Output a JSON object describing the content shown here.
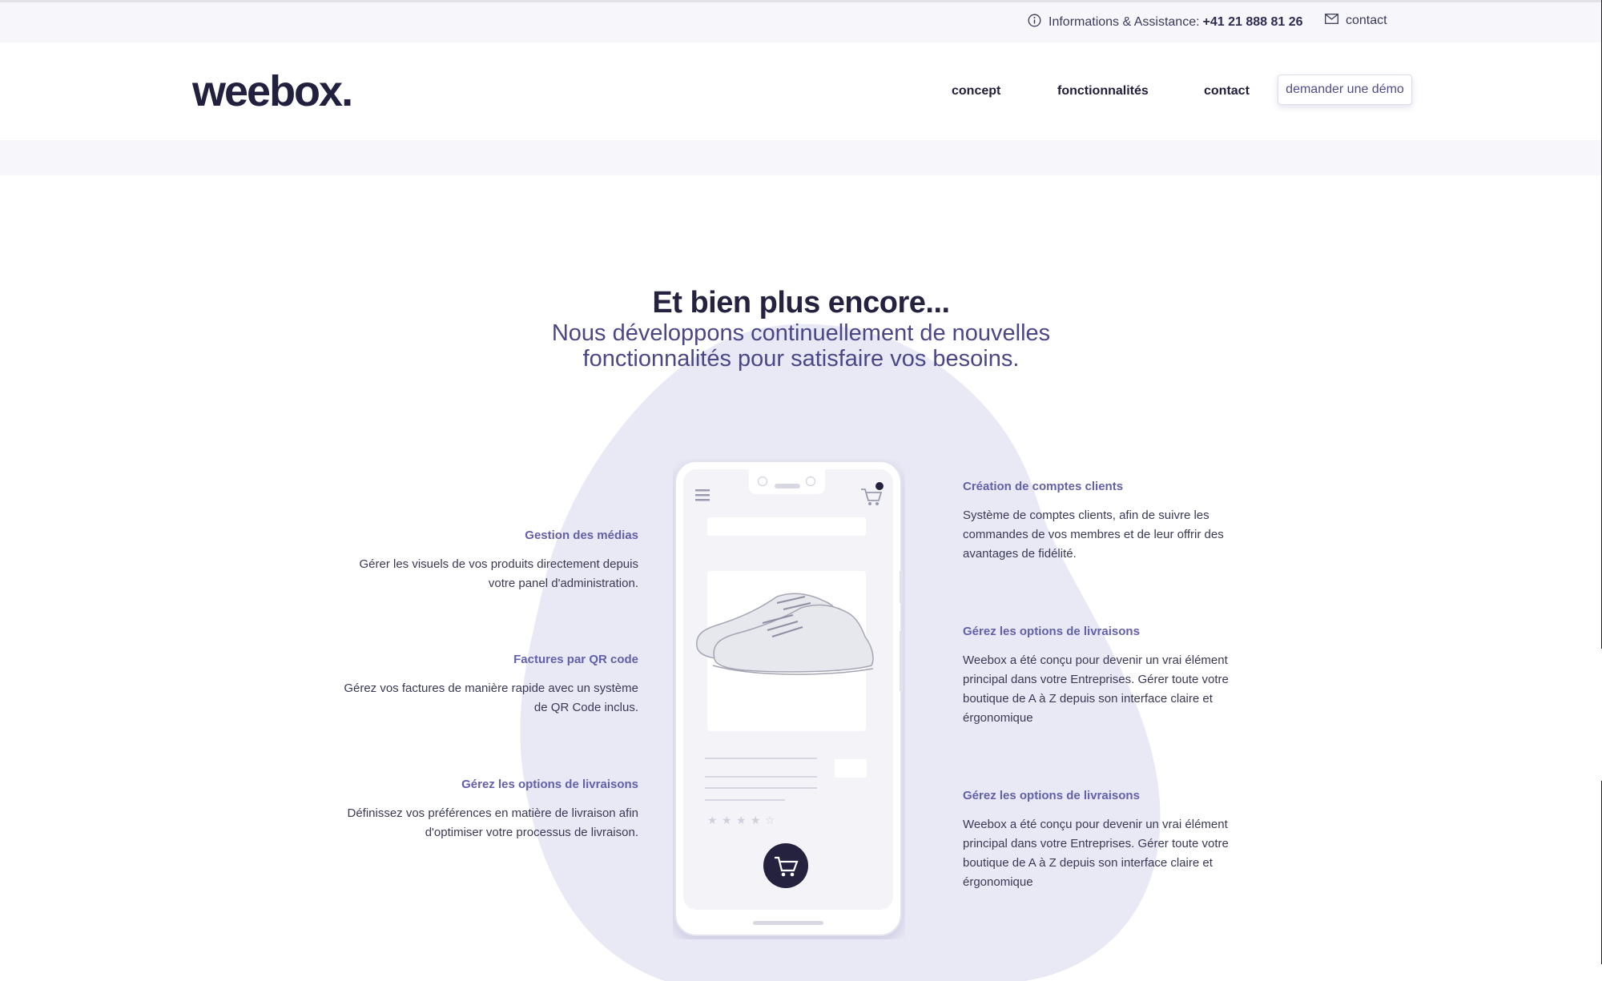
{
  "topbar": {
    "info_label": "Informations & Assistance:",
    "phone": "+41 21 888 81 26",
    "contact_label": "contact"
  },
  "header": {
    "logo": "weebox.",
    "nav": [
      "concept",
      "fonctionnalités",
      "contact"
    ],
    "demo_button": "demander une démo"
  },
  "hero": {
    "title": "Et bien plus encore...",
    "subtitle_line1": "Nous développons continuellement de nouvelles",
    "subtitle_line2": "fonctionnalités pour satisfaire vos besoins."
  },
  "features_left": [
    {
      "title": "Gestion des médias",
      "line1": "Gérer les visuels de vos produits directement depuis",
      "line2": "votre panel d'administration."
    },
    {
      "title": "Factures par QR code",
      "line1": "Gérez vos factures de manière rapide avec un système",
      "line2": "de QR Code inclus."
    },
    {
      "title": "Gérez les options de livraisons",
      "line1": "Définissez vos préférences en matière de livraison afin",
      "line2": "d'optimiser votre processus de livraison."
    }
  ],
  "features_right": [
    {
      "title": "Création de comptes clients",
      "line1": "Système de comptes clients, afin de suivre les",
      "line2": "commandes de vos membres et de leur offrir des",
      "line3": "avantages de fidélité.",
      "line4": ""
    },
    {
      "title": "Gérez les options de livraisons",
      "line1": "Weebox a été conçu pour devenir un vrai élément",
      "line2": "principal dans votre Entreprises. Gérer toute votre",
      "line3": "boutique de A à Z depuis son interface claire et",
      "line4": "érgonomique"
    },
    {
      "title": "Gérez les options de livraisons",
      "line1": "Weebox a été conçu pour devenir un vrai élément",
      "line2": "principal dans votre Entreprises. Gérer toute votre",
      "line3": "boutique de A à Z depuis son interface claire et",
      "line4": "érgonomique"
    }
  ],
  "icons": {
    "info": "info-icon",
    "mail": "mail-icon",
    "menu": "hamburger-menu-icon",
    "cart": "cart-icon",
    "star": "star-icon"
  },
  "colors": {
    "accent": "#6260a9",
    "dark": "#24223f",
    "blob": "#e9e9f6",
    "band": "#f6f6fb"
  }
}
